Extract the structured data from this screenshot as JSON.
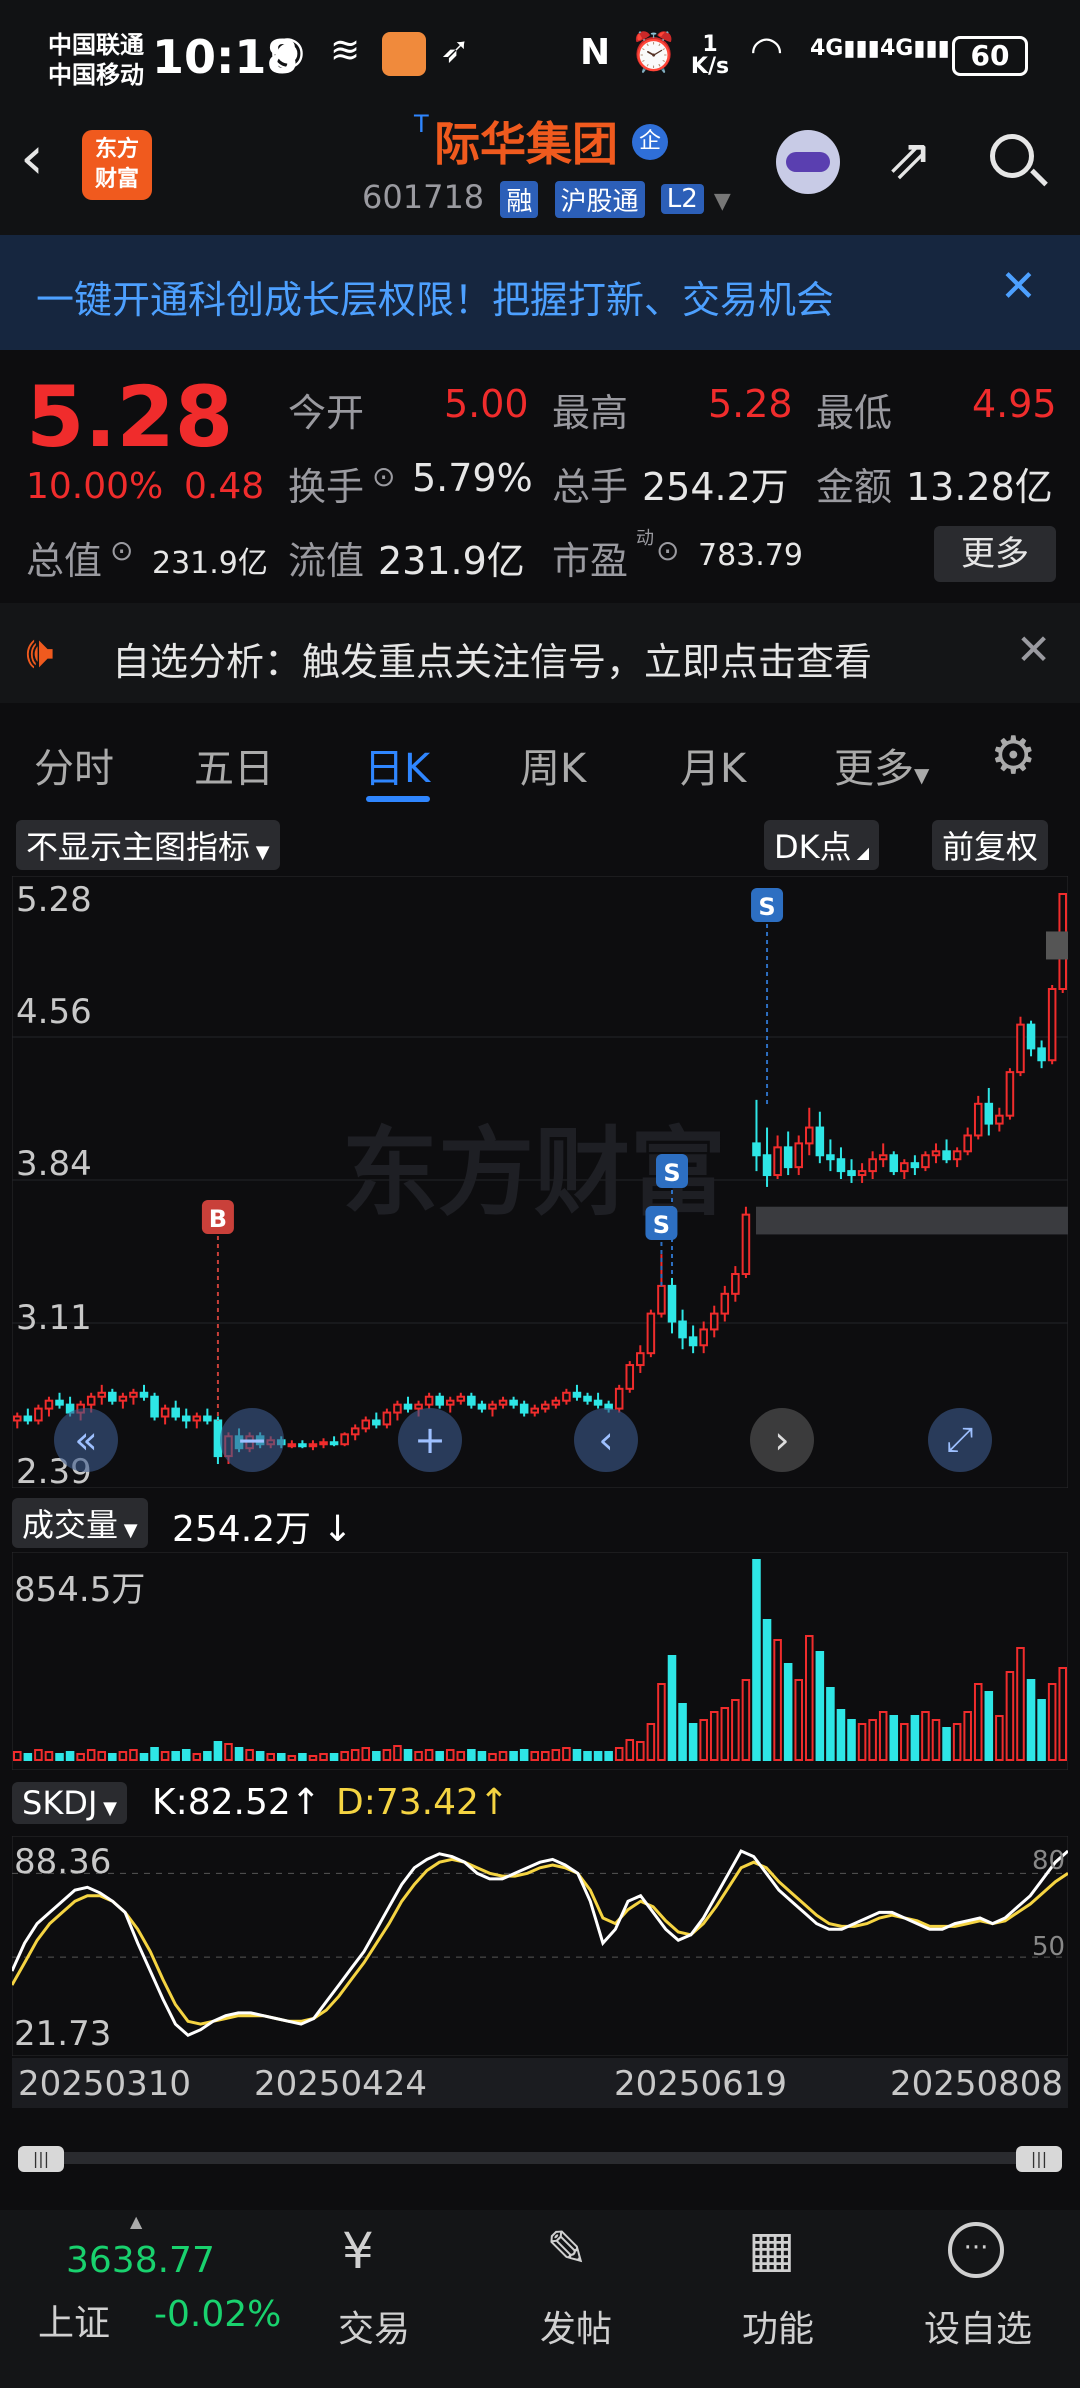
{
  "status": {
    "carrier1": "中国联通",
    "carrier2": "中国移动",
    "time": "10:18",
    "net_speed": "1 K/s",
    "battery": "60"
  },
  "header": {
    "back_icon": "chevron-left-icon",
    "logo_line1": "东方",
    "logo_line2": "财富",
    "t_mark": "T",
    "name": "际华集团",
    "name_badge": "企",
    "code": "601718",
    "tag1": "融",
    "tag2": "沪股通",
    "tag3": "L2"
  },
  "banner": {
    "text": "一键开通科创成长层权限！把握打新、交易机会"
  },
  "quote": {
    "price": "5.28",
    "change_pct": "10.00%",
    "change": "0.48",
    "open_label": "今开",
    "open": "5.00",
    "high_label": "最高",
    "high": "5.28",
    "low_label": "最低",
    "low": "4.95",
    "turnover_label": "换手",
    "turnover": "5.79%",
    "volume_label": "总手",
    "volume": "254.2万",
    "amount_label": "金额",
    "amount": "13.28亿",
    "mktcap_label": "总值",
    "mktcap": "231.9亿",
    "float_label": "流值",
    "float": "231.9亿",
    "pe_label": "市盈",
    "pe_sup": "动",
    "pe": "783.79",
    "more": "更多"
  },
  "alert": {
    "text": "自选分析：触发重点关注信号，立即点击查看"
  },
  "tabs": [
    "分时",
    "五日",
    "日K",
    "周K",
    "月K",
    "更多"
  ],
  "active_tab": 2,
  "chart_toolbar": {
    "indicator": "不显示主图指标",
    "dk": "DK点",
    "adjust": "前复权"
  },
  "volume_panel": {
    "label": "成交量",
    "value": "254.2万",
    "arrow": "↓",
    "max": "854.5万"
  },
  "skdj_panel": {
    "label": "SKDJ",
    "k": "K:82.52↑",
    "d": "D:73.42↑",
    "top": "88.36",
    "bottom": "21.73",
    "ref80": "80",
    "ref50": "50"
  },
  "dates": [
    "20250310",
    "20250424",
    "20250619",
    "20250808"
  ],
  "bottom_nav": {
    "index_value": "3638.77",
    "index_name": "上证",
    "index_change": "-0.02%",
    "trade": "交易",
    "post": "发帖",
    "func": "功能",
    "watch": "设自选"
  },
  "chart_data": {
    "type": "candlestick",
    "y_ticks": [
      "5.28",
      "4.56",
      "3.84",
      "3.11",
      "2.39"
    ],
    "ylim": [
      2.39,
      5.28
    ],
    "markers": [
      {
        "label": "B"
      },
      {
        "label": "S"
      },
      {
        "label": "S"
      },
      {
        "label": "S"
      }
    ],
    "watermark": "东方财富",
    "candles": [
      [
        2.62,
        2.66,
        2.58,
        2.64
      ],
      [
        2.64,
        2.68,
        2.6,
        2.62
      ],
      [
        2.62,
        2.7,
        2.6,
        2.68
      ],
      [
        2.68,
        2.74,
        2.64,
        2.72
      ],
      [
        2.72,
        2.76,
        2.68,
        2.7
      ],
      [
        2.7,
        2.74,
        2.64,
        2.66
      ],
      [
        2.66,
        2.72,
        2.62,
        2.7
      ],
      [
        2.7,
        2.76,
        2.66,
        2.74
      ],
      [
        2.74,
        2.8,
        2.7,
        2.76
      ],
      [
        2.76,
        2.78,
        2.7,
        2.72
      ],
      [
        2.72,
        2.76,
        2.68,
        2.74
      ],
      [
        2.74,
        2.78,
        2.7,
        2.76
      ],
      [
        2.76,
        2.8,
        2.72,
        2.74
      ],
      [
        2.74,
        2.76,
        2.62,
        2.64
      ],
      [
        2.64,
        2.7,
        2.6,
        2.68
      ],
      [
        2.68,
        2.72,
        2.62,
        2.64
      ],
      [
        2.64,
        2.68,
        2.58,
        2.62
      ],
      [
        2.62,
        2.66,
        2.58,
        2.64
      ],
      [
        2.64,
        2.68,
        2.6,
        2.62
      ],
      [
        2.62,
        2.64,
        2.4,
        2.44
      ],
      [
        2.44,
        2.56,
        2.4,
        2.54
      ],
      [
        2.54,
        2.58,
        2.46,
        2.48
      ],
      [
        2.48,
        2.56,
        2.46,
        2.54
      ],
      [
        2.54,
        2.56,
        2.48,
        2.5
      ],
      [
        2.5,
        2.54,
        2.48,
        2.52
      ],
      [
        2.52,
        2.54,
        2.48,
        2.5
      ],
      [
        2.5,
        2.52,
        2.48,
        2.5
      ],
      [
        2.5,
        2.52,
        2.48,
        2.49
      ],
      [
        2.49,
        2.52,
        2.47,
        2.5
      ],
      [
        2.5,
        2.53,
        2.48,
        2.51
      ],
      [
        2.51,
        2.54,
        2.49,
        2.5
      ],
      [
        2.5,
        2.56,
        2.49,
        2.55
      ],
      [
        2.55,
        2.6,
        2.52,
        2.58
      ],
      [
        2.58,
        2.64,
        2.56,
        2.62
      ],
      [
        2.62,
        2.66,
        2.58,
        2.6
      ],
      [
        2.6,
        2.68,
        2.58,
        2.66
      ],
      [
        2.66,
        2.72,
        2.62,
        2.7
      ],
      [
        2.7,
        2.74,
        2.66,
        2.68
      ],
      [
        2.68,
        2.72,
        2.64,
        2.7
      ],
      [
        2.7,
        2.76,
        2.68,
        2.74
      ],
      [
        2.74,
        2.76,
        2.68,
        2.7
      ],
      [
        2.7,
        2.74,
        2.66,
        2.72
      ],
      [
        2.72,
        2.76,
        2.7,
        2.74
      ],
      [
        2.74,
        2.76,
        2.68,
        2.7
      ],
      [
        2.7,
        2.72,
        2.66,
        2.68
      ],
      [
        2.68,
        2.72,
        2.64,
        2.7
      ],
      [
        2.7,
        2.74,
        2.68,
        2.72
      ],
      [
        2.72,
        2.74,
        2.68,
        2.7
      ],
      [
        2.7,
        2.72,
        2.64,
        2.66
      ],
      [
        2.66,
        2.7,
        2.64,
        2.68
      ],
      [
        2.68,
        2.72,
        2.66,
        2.7
      ],
      [
        2.7,
        2.74,
        2.68,
        2.72
      ],
      [
        2.72,
        2.78,
        2.7,
        2.76
      ],
      [
        2.76,
        2.8,
        2.72,
        2.74
      ],
      [
        2.74,
        2.76,
        2.7,
        2.72
      ],
      [
        2.72,
        2.76,
        2.68,
        2.7
      ],
      [
        2.7,
        2.72,
        2.66,
        2.68
      ],
      [
        2.68,
        2.8,
        2.66,
        2.78
      ],
      [
        2.78,
        2.92,
        2.76,
        2.9
      ],
      [
        2.9,
        3.0,
        2.86,
        2.96
      ],
      [
        2.96,
        3.18,
        2.94,
        3.16
      ],
      [
        3.16,
        3.46,
        3.14,
        3.3
      ],
      [
        3.3,
        3.34,
        3.06,
        3.12
      ],
      [
        3.12,
        3.18,
        2.98,
        3.04
      ],
      [
        3.04,
        3.1,
        2.96,
        3.0
      ],
      [
        3.0,
        3.12,
        2.96,
        3.08
      ],
      [
        3.08,
        3.2,
        3.04,
        3.16
      ],
      [
        3.16,
        3.3,
        3.12,
        3.26
      ],
      [
        3.26,
        3.4,
        3.22,
        3.36
      ],
      [
        3.36,
        3.7,
        3.34,
        3.66
      ],
      [
        4.02,
        4.24,
        3.88,
        3.96
      ],
      [
        3.96,
        4.1,
        3.8,
        3.86
      ],
      [
        3.86,
        4.06,
        3.84,
        4.0
      ],
      [
        4.0,
        4.08,
        3.86,
        3.9
      ],
      [
        3.9,
        4.06,
        3.86,
        4.02
      ],
      [
        4.02,
        4.2,
        3.96,
        4.1
      ],
      [
        4.1,
        4.18,
        3.92,
        3.96
      ],
      [
        3.96,
        4.04,
        3.88,
        3.94
      ],
      [
        3.94,
        4.0,
        3.84,
        3.88
      ],
      [
        3.88,
        3.94,
        3.82,
        3.86
      ],
      [
        3.86,
        3.92,
        3.82,
        3.88
      ],
      [
        3.88,
        3.98,
        3.84,
        3.94
      ],
      [
        3.94,
        4.02,
        3.9,
        3.96
      ],
      [
        3.96,
        3.98,
        3.86,
        3.88
      ],
      [
        3.88,
        3.94,
        3.84,
        3.92
      ],
      [
        3.92,
        3.96,
        3.86,
        3.9
      ],
      [
        3.9,
        3.98,
        3.88,
        3.96
      ],
      [
        3.96,
        4.02,
        3.92,
        3.98
      ],
      [
        3.98,
        4.04,
        3.92,
        3.94
      ],
      [
        3.94,
        4.0,
        3.9,
        3.98
      ],
      [
        3.98,
        4.1,
        3.96,
        4.06
      ],
      [
        4.06,
        4.26,
        4.04,
        4.22
      ],
      [
        4.22,
        4.3,
        4.06,
        4.12
      ],
      [
        4.12,
        4.2,
        4.08,
        4.16
      ],
      [
        4.16,
        4.4,
        4.14,
        4.38
      ],
      [
        4.38,
        4.66,
        4.36,
        4.62
      ],
      [
        4.62,
        4.64,
        4.46,
        4.5
      ],
      [
        4.5,
        4.54,
        4.4,
        4.44
      ],
      [
        4.44,
        4.82,
        4.42,
        4.8
      ],
      [
        4.8,
        5.28,
        4.78,
        5.28
      ]
    ],
    "volume": [
      0.04,
      0.03,
      0.05,
      0.04,
      0.03,
      0.04,
      0.03,
      0.05,
      0.04,
      0.03,
      0.04,
      0.05,
      0.03,
      0.06,
      0.04,
      0.04,
      0.05,
      0.03,
      0.04,
      0.09,
      0.08,
      0.06,
      0.05,
      0.04,
      0.03,
      0.03,
      0.02,
      0.03,
      0.02,
      0.03,
      0.03,
      0.04,
      0.05,
      0.06,
      0.04,
      0.05,
      0.07,
      0.05,
      0.04,
      0.05,
      0.04,
      0.05,
      0.04,
      0.05,
      0.04,
      0.03,
      0.04,
      0.04,
      0.05,
      0.04,
      0.04,
      0.05,
      0.06,
      0.05,
      0.04,
      0.04,
      0.04,
      0.06,
      0.1,
      0.09,
      0.18,
      0.38,
      0.52,
      0.28,
      0.18,
      0.2,
      0.24,
      0.26,
      0.3,
      0.4,
      1.0,
      0.7,
      0.6,
      0.48,
      0.4,
      0.62,
      0.54,
      0.36,
      0.25,
      0.2,
      0.18,
      0.2,
      0.24,
      0.22,
      0.18,
      0.22,
      0.24,
      0.2,
      0.16,
      0.18,
      0.24,
      0.38,
      0.34,
      0.22,
      0.44,
      0.56,
      0.4,
      0.3,
      0.38,
      0.46
    ]
  }
}
